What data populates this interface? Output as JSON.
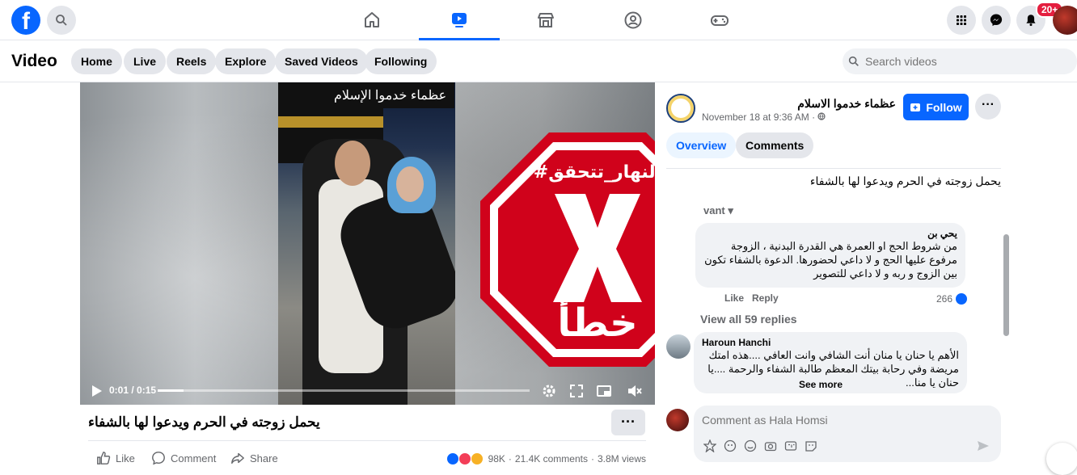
{
  "header": {
    "logo": "facebook-logo",
    "nav_tabs": [
      "home-icon",
      "video-icon",
      "marketplace-icon",
      "groups-icon",
      "gaming-icon"
    ],
    "active_tab": "video-icon",
    "notification_badge": "20+"
  },
  "subnav": {
    "title": "Video",
    "pills": [
      "Home",
      "Live",
      "Reels",
      "Explore",
      "Saved Videos",
      "Following"
    ],
    "search_placeholder": "Search videos"
  },
  "player": {
    "overlay_caption": "عظماء خدموا الإسلام",
    "stamp_hashtag": "#النهار_تتحقق",
    "stamp_verdict": "خطأ",
    "time": "0:01 / 0:15",
    "progress": 0.07
  },
  "post": {
    "title": "يحمل زوجته في الحرم ويدعوا لها بالشفاء",
    "more": "···",
    "like_label": "Like",
    "comment_label": "Comment",
    "share_label": "Share",
    "reactions_count": "98K",
    "comments_count": "21.4K comments",
    "views": "3.8M views",
    "separator": "·"
  },
  "sidebar": {
    "page_name": "عظماء خدموا الاسلام",
    "date": "November 18 at 9:36 AM · ",
    "follow_label": "Follow",
    "more": "···",
    "tabs": [
      "Overview",
      "Comments"
    ],
    "description": "يحمل زوجته في الحرم ويدعوا لها بالشفاء",
    "sort_label": "vant ▾",
    "comments": [
      {
        "author": "يحي بن",
        "text": "من شروط الحج او العمرة هي القدرة البدنية ، الزوجة مرفوع عليها الحج و لا داعي لحضورها. الدعوة بالشفاء تكون بين الزوج و ربه و لا داعي للتصوير",
        "like": "Like",
        "reply": "Reply",
        "likes": "266"
      },
      {
        "author": "Haroun Hanchi",
        "text": "الأهم يا حنان يا منان أنت الشافي وانت العافي ....هذه امتك مريضة وفي رحابة بيتك المعظم طالبة الشفاء والرحمة ....يا حنان يا منا...",
        "see_more": "See more"
      }
    ],
    "view_replies": "View all 59 replies",
    "comment_placeholder": "Comment as Hala Homsi"
  }
}
